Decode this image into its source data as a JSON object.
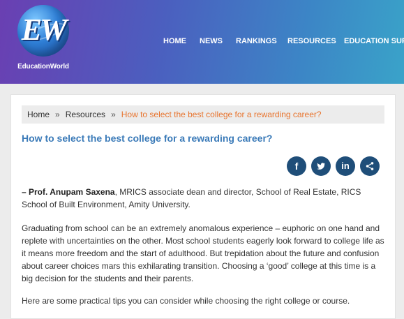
{
  "site": {
    "logo_letters": "EW",
    "logo_name": "EducationWorld"
  },
  "nav": {
    "items": [
      "HOME",
      "NEWS",
      "RANKINGS",
      "RESOURCES",
      "EDUCATION SUPP"
    ]
  },
  "breadcrumb": {
    "home": "Home",
    "sep": "»",
    "section": "Resources",
    "current": "How to select the best college for a rewarding career?"
  },
  "article": {
    "title": "How to select the best college for a rewarding career?",
    "author_prefix": "– Prof. Anupam Saxena",
    "author_rest": ", MRICS associate dean and director, School of Real Estate, RICS School of Built Environment, Amity University.",
    "paragraphs": [
      "Graduating from school can be an extremely anomalous experience – euphoric on one hand and replete with uncertainties on the other. Most school students eagerly look forward to college life as it means more freedom and the start of adulthood. But trepidation about the future and confusion about career choices mars this exhilarating transition. Choosing a ‘good’ college at this time is a big decision for the students and their parents.",
      "Here are some practical tips you can consider while choosing the right college or course."
    ]
  },
  "share": {
    "facebook": "f",
    "twitter": "twitter-icon",
    "linkedin": "in",
    "share": "share-icon"
  },
  "colors": {
    "accent": "#3a7ab8",
    "breadcrumb_current": "#e8742e",
    "share_button": "#1f4e79"
  }
}
